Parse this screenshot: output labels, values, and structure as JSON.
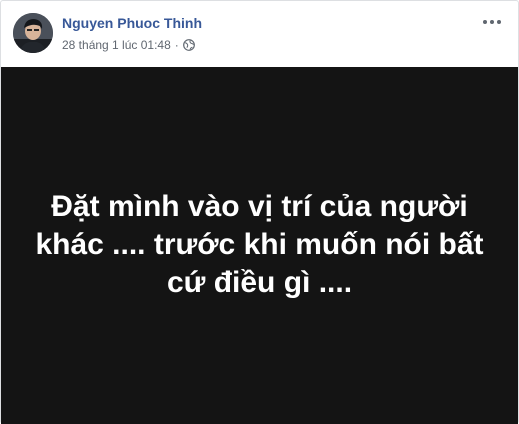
{
  "post": {
    "author": "Nguyen Phuoc Thinh",
    "timestamp": "28 tháng 1 lúc 01:48",
    "separator": "·",
    "privacy_icon": "globe-icon",
    "options_icon": "more-options-icon",
    "text": "Đặt mình vào vị trí của người khác .... trước khi muốn nói bất cứ điều gì ....",
    "colors": {
      "author": "#385898",
      "meta": "#606770",
      "media_background": "#141414",
      "media_text": "#ffffff"
    }
  }
}
